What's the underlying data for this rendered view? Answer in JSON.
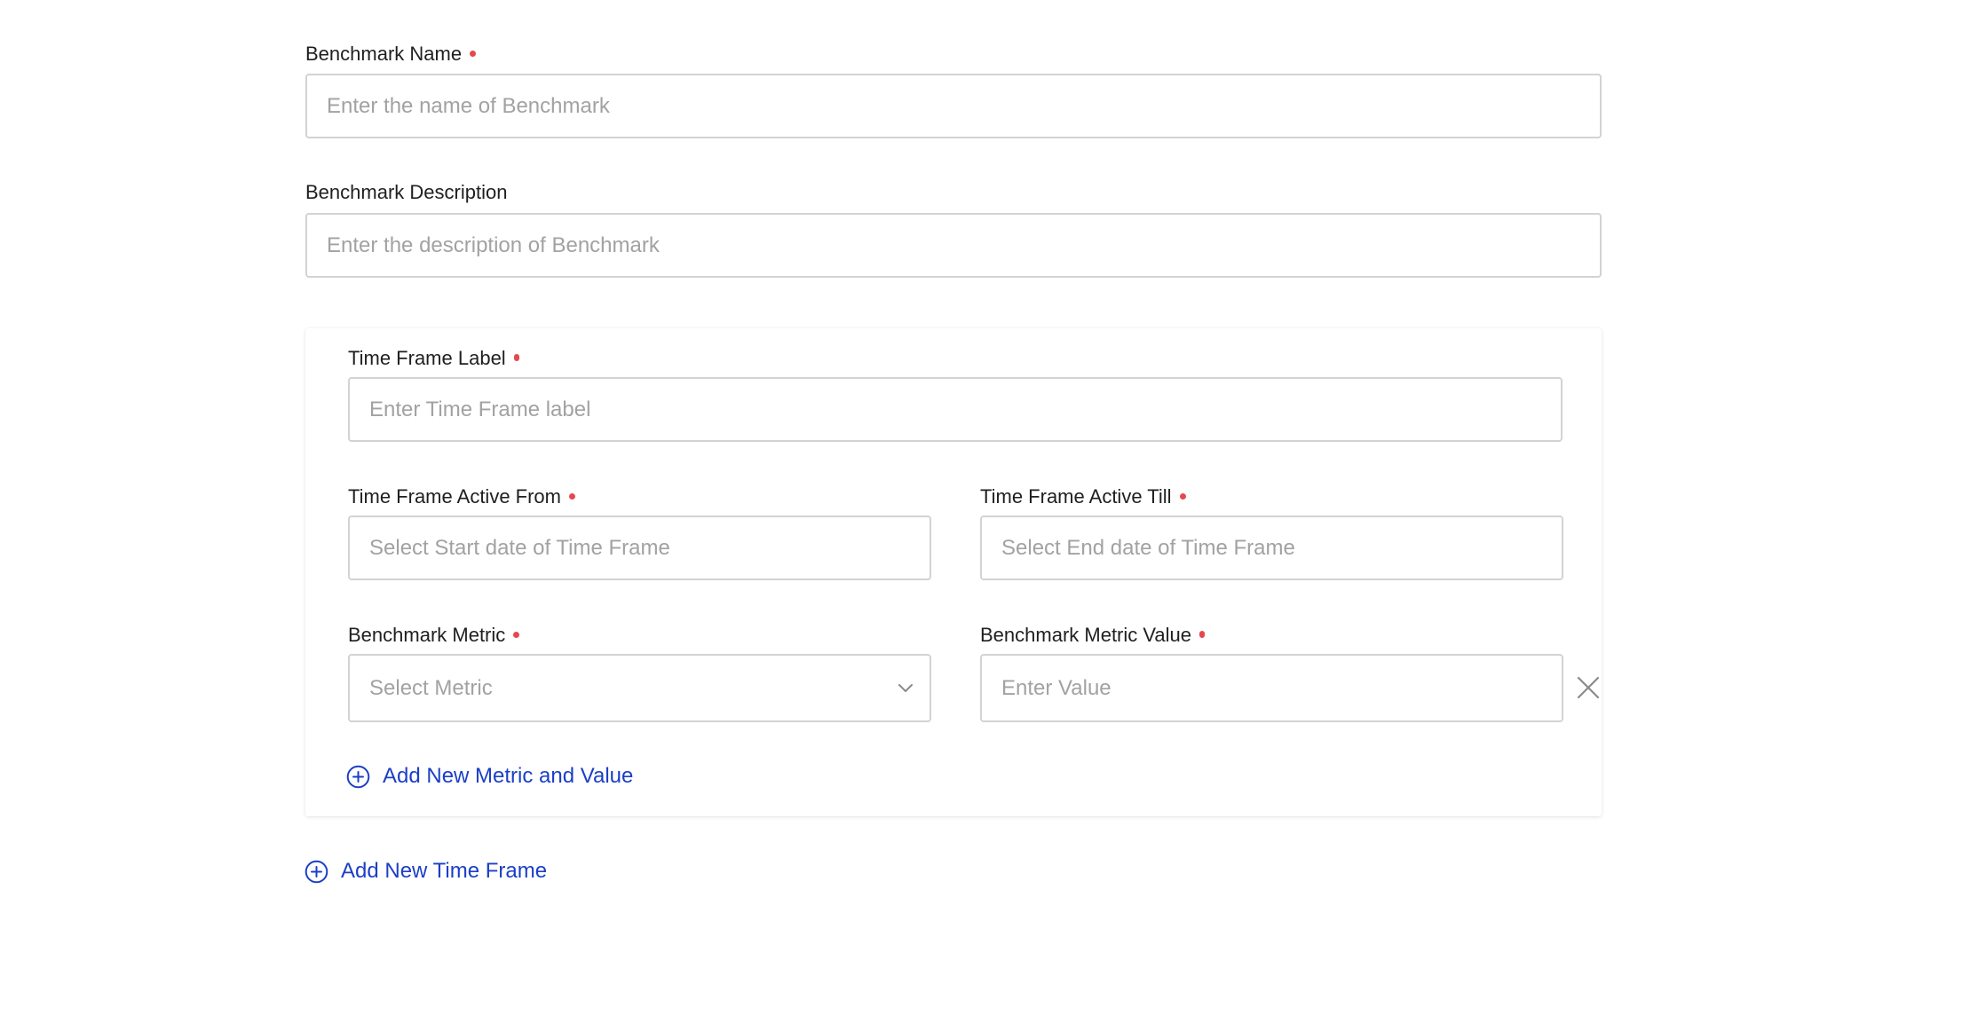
{
  "benchmark_name": {
    "label": "Benchmark Name",
    "placeholder": "Enter the name of Benchmark"
  },
  "benchmark_description": {
    "label": "Benchmark Description",
    "placeholder": "Enter the description of Benchmark"
  },
  "time_frame": {
    "label_field": {
      "label": "Time Frame Label",
      "placeholder": "Enter Time Frame label"
    },
    "active_from": {
      "label": "Time Frame Active From",
      "placeholder": "Select Start date of Time Frame"
    },
    "active_till": {
      "label": "Time Frame Active Till",
      "placeholder": "Select End date of Time Frame"
    },
    "metric": {
      "label": "Benchmark Metric",
      "placeholder": "Select Metric"
    },
    "metric_value": {
      "label": "Benchmark Metric Value",
      "placeholder": "Enter Value"
    },
    "add_metric_label": "Add New Metric and Value"
  },
  "add_time_frame_label": "Add New Time Frame",
  "icons": {
    "required": "required-dot-icon",
    "chevron": "chevron-down-icon",
    "remove": "close-icon",
    "add": "plus-circle-icon"
  },
  "colors": {
    "required": "#e5484d",
    "link": "#1b3fc7",
    "border": "#d3d3d3",
    "placeholder": "#a2a2a2"
  }
}
